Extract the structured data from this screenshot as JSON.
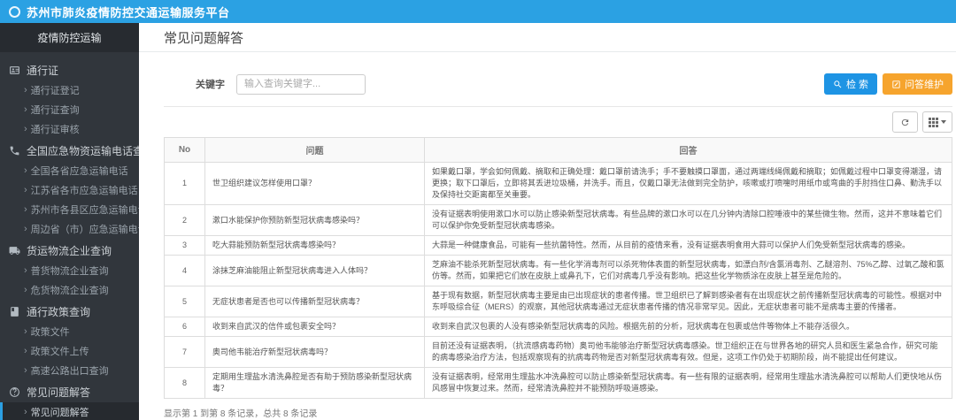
{
  "colors": {
    "topbar_bg": "#2BA1E3",
    "sidebar_bg": "#31363C",
    "sidebar_header_bg": "#272B30",
    "active_accent": "#2B9FE2",
    "search_button_bg": "#1E94E4",
    "maintain_button_bg": "#F6A42D",
    "table_border": "#DDDDDD"
  },
  "icons": {
    "logo": "circle-outline",
    "chevron": "›",
    "group_icons": [
      "id-card",
      "phone",
      "truck",
      "book",
      "question-circle"
    ],
    "search_button_icon": "magnifier",
    "maintain_button_icon": "edit-pencil",
    "toolbar_icons": [
      "refresh",
      "columns-grid",
      "caret-down"
    ]
  },
  "topbar": {
    "title": "苏州市肺炎疫情防控交通运输服务平台"
  },
  "sidebar": {
    "header": "疫情防控运输",
    "groups": [
      {
        "label": "通行证",
        "items": [
          "通行证登记",
          "通行证查询",
          "通行证审核"
        ]
      },
      {
        "label": "全国应急物资运输电话查询",
        "items": [
          "全国各省应急运输电话",
          "江苏省各市应急运输电话",
          "苏州市各县区应急运输电话",
          "周边省（市）应急运输电话"
        ]
      },
      {
        "label": "货运物流企业查询",
        "items": [
          "普货物流企业查询",
          "危货物流企业查询"
        ]
      },
      {
        "label": "通行政策查询",
        "items": [
          "政策文件",
          "政策文件上传",
          "高速公路出口查询"
        ]
      },
      {
        "label": "常见问题解答",
        "items": [
          "常见问题解答"
        ],
        "active_item_index": 0
      }
    ]
  },
  "page": {
    "title": "常见问题解答"
  },
  "search": {
    "label": "关键字",
    "placeholder": "输入查询关键字...",
    "value": "",
    "search_button": "检 索",
    "maintain_button": "问答维护"
  },
  "table": {
    "columns": [
      "No",
      "问题",
      "回答"
    ],
    "rows": [
      {
        "no": "1",
        "question": "世卫组织建议怎样使用口罩？",
        "answer": "如果戴口罩，学会如何佩戴、摘取和正确处理：戴口罩前请洗手；手不要触摸口罩面，通过两端线绳佩戴和摘取；如佩戴过程中口罩变得潮湿，请更换；取下口罩后，立即将其丢进垃圾桶，并洗手。而且，仅戴口罩无法做到完全防护，咳嗽或打喷嚏时用纸巾或弯曲的手肘挡住口鼻、勤洗手以及保持社交距离都至关重要。"
      },
      {
        "no": "2",
        "question": "漱口水能保护你预防新型冠状病毒感染吗？",
        "answer": "没有证据表明使用漱口水可以防止感染新型冠状病毒。有些品牌的漱口水可以在几分钟内清除口腔唾液中的某些微生物。然而，这并不意味着它们可以保护你免受新型冠状病毒感染。"
      },
      {
        "no": "3",
        "question": "吃大蒜能预防新型冠状病毒感染吗？",
        "answer": "大蒜是一种健康食品，可能有一些抗菌特性。然而，从目前的疫情来看，没有证据表明食用大蒜可以保护人们免受新型冠状病毒的感染。"
      },
      {
        "no": "4",
        "question": "涂抹芝麻油能阻止新型冠状病毒进入人体吗？",
        "answer": "芝麻油不能杀死新型冠状病毒。有一些化学消毒剂可以杀死物体表面的新型冠状病毒，如漂白剂/含氯消毒剂、乙醚溶剂、75%乙醇、过氧乙酸和氯仿等。然而，如果把它们放在皮肤上或鼻孔下，它们对病毒几乎没有影响。把这些化学物质涂在皮肤上甚至是危险的。"
      },
      {
        "no": "5",
        "question": "无症状患者是否也可以传播新型冠状病毒？",
        "answer": "基于现有数据，新型冠状病毒主要是由已出现症状的患者传播。世卫组织已了解到感染者有在出现症状之前传播新型冠状病毒的可能性。根据对中东呼吸综合征（MERS）的观察，其他冠状病毒通过无症状患者传播的情况非常罕见。因此，无症状患者可能不是病毒主要的传播者。"
      },
      {
        "no": "6",
        "question": "收到来自武汉的信件或包裹安全吗？",
        "answer": "收到来自武汉包裹的人没有感染新型冠状病毒的风险。根据先前的分析，冠状病毒在包裹或信件等物体上不能存活很久。"
      },
      {
        "no": "7",
        "question": "奥司他韦能治疗新型冠状病毒吗？",
        "answer": "目前还没有证据表明，（抗流感病毒药物）奥司他韦能够治疗新型冠状病毒感染。世卫组织正在与世界各地的研究人员和医生紧急合作，研究可能的病毒感染治疗方法，包括观察现有的抗病毒药物是否对新型冠状病毒有效。但是，这项工作仍处于初期阶段，尚不能提出任何建议。"
      },
      {
        "no": "8",
        "question": "定期用生理盐水清洗鼻腔是否有助于预防感染新型冠状病毒？",
        "answer": "没有证据表明，经常用生理盐水冲洗鼻腔可以防止感染新型冠状病毒。有一些有限的证据表明，经常用生理盐水清洗鼻腔可以帮助人们更快地从伤风感冒中恢复过来。然而，经常清洗鼻腔并不能预防呼吸道感染。"
      }
    ]
  },
  "pagination": {
    "summary": "显示第 1 到第 8 条记录，总共 8 条记录"
  }
}
